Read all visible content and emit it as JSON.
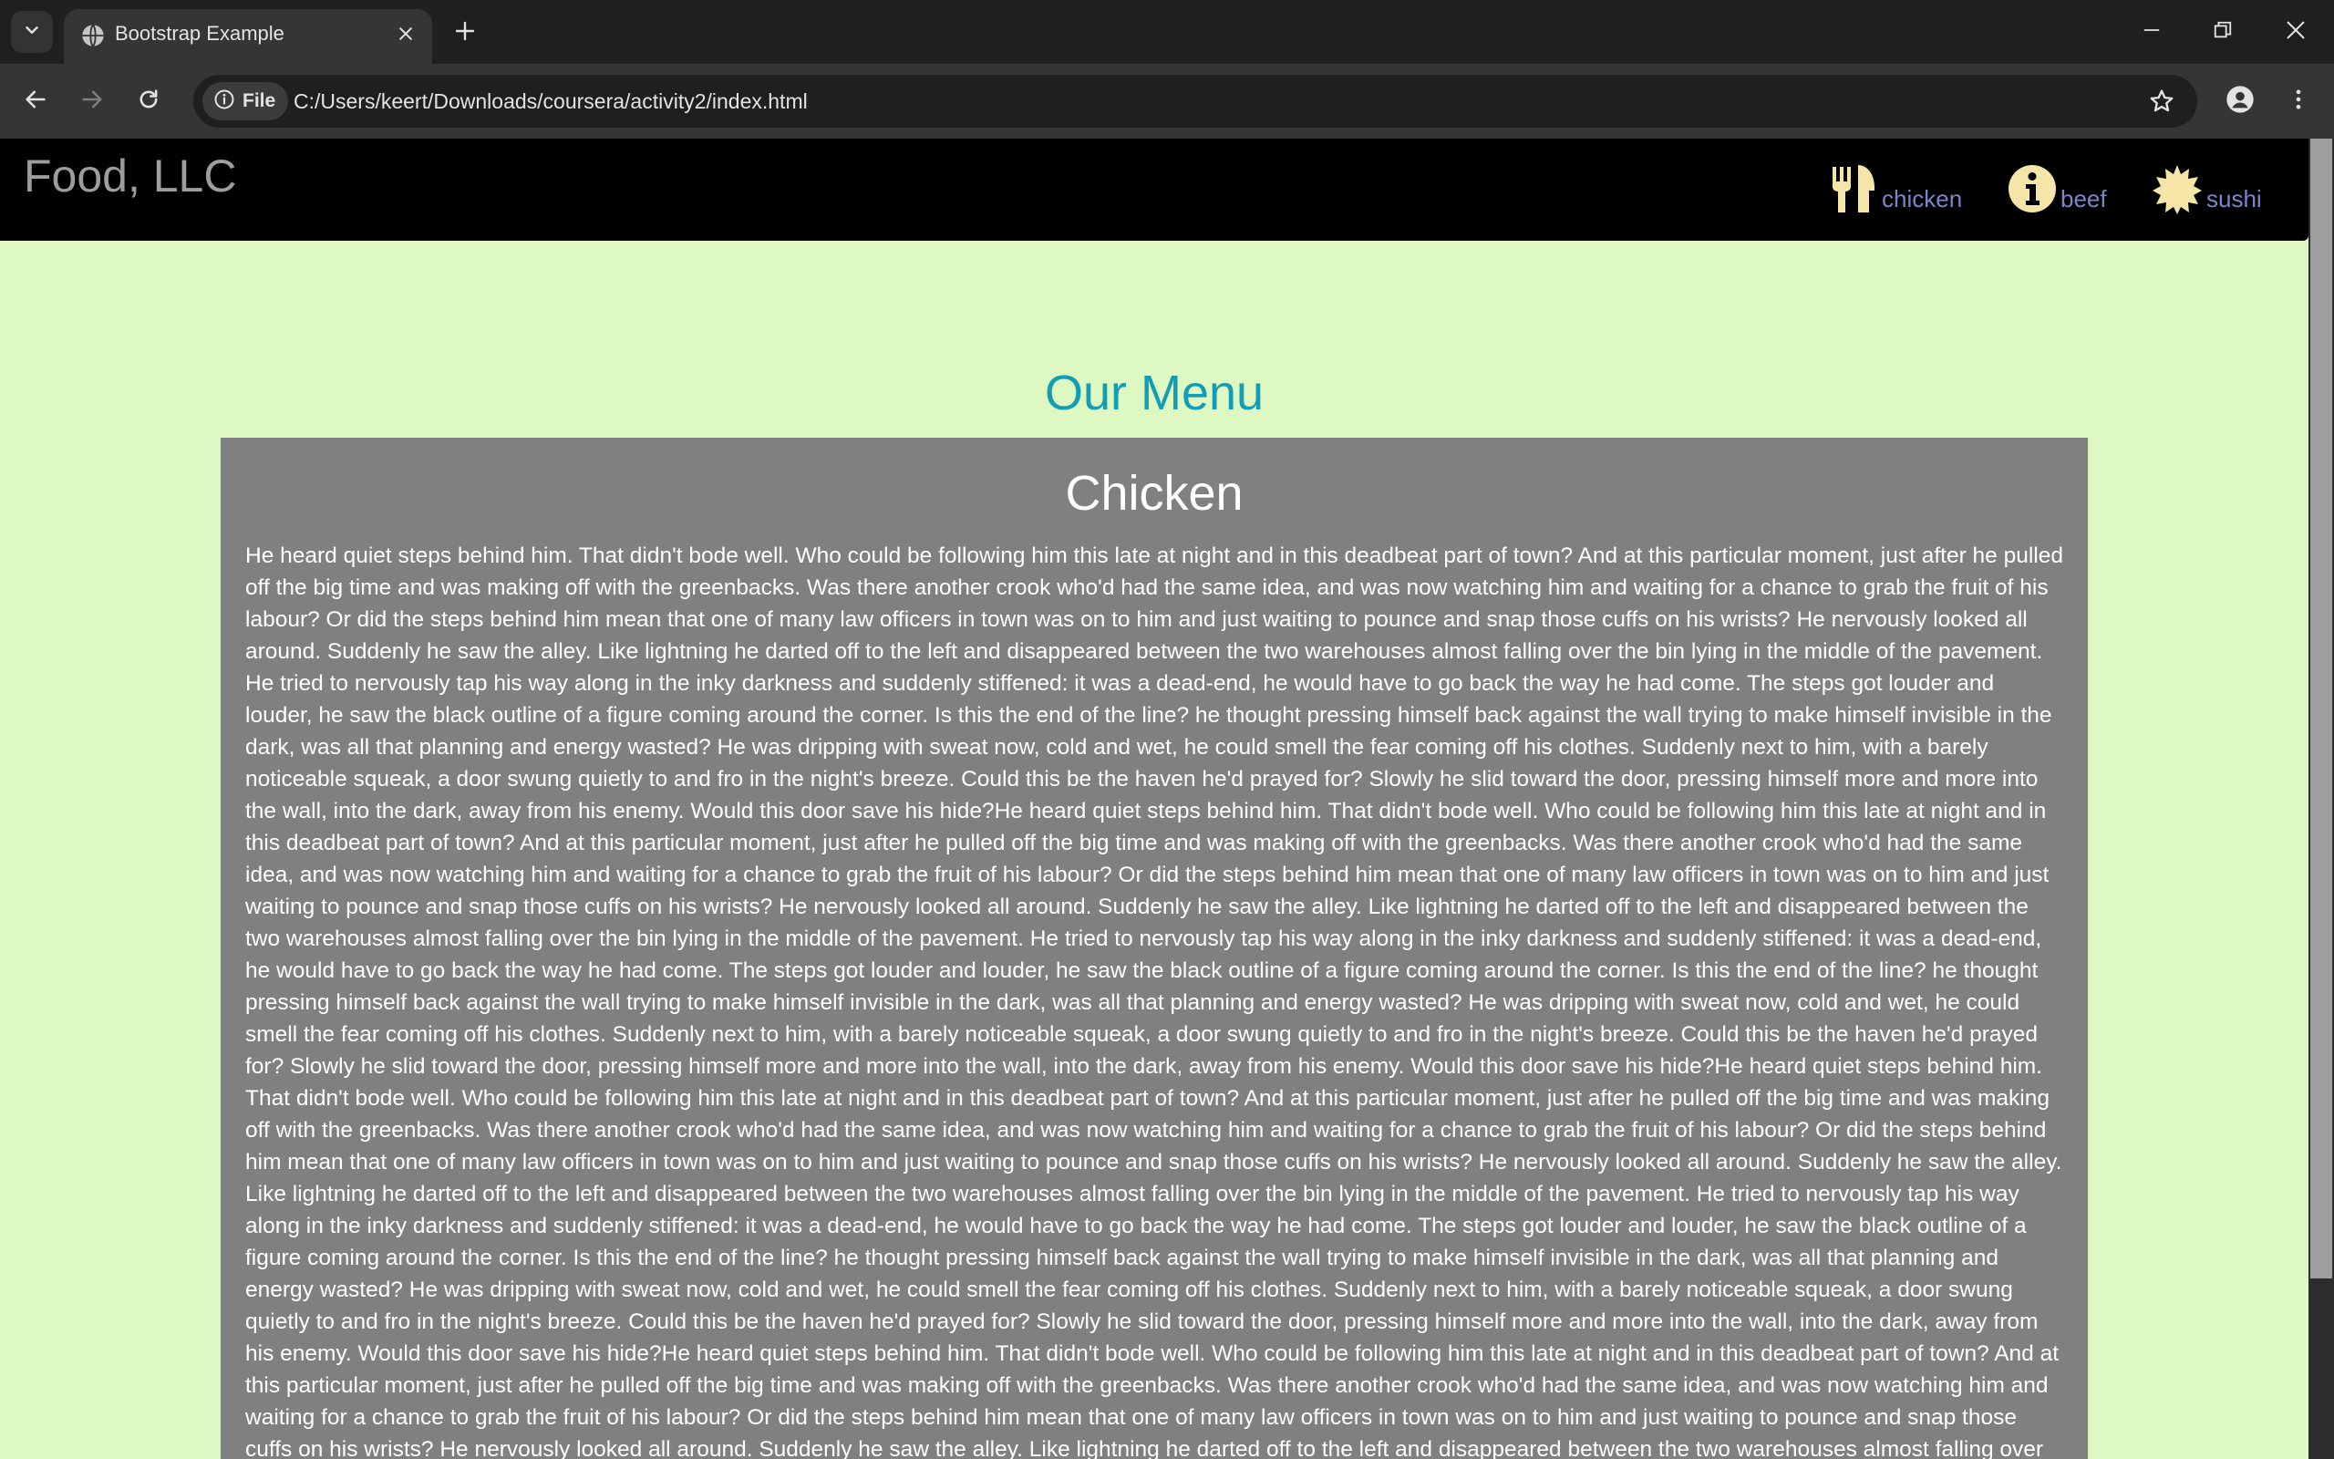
{
  "browser": {
    "tab_title": "Bootstrap Example",
    "site_chip_label": "File",
    "url": "C:/Users/keert/Downloads/coursera/activity2/index.html",
    "icons": [
      "tab-list-icon",
      "globe-icon",
      "close-icon",
      "plus-icon",
      "minimize-icon",
      "restore-icon",
      "close-window-icon",
      "back-arrow-icon",
      "forward-arrow-icon",
      "reload-icon",
      "info-icon",
      "star-icon",
      "profile-icon",
      "more-vert-icon"
    ]
  },
  "page": {
    "brand": "Food, LLC",
    "nav": [
      {
        "label": "chicken",
        "icon": "cutlery-icon"
      },
      {
        "label": "beef",
        "icon": "info-sign-icon"
      },
      {
        "label": "sushi",
        "icon": "certificate-icon"
      }
    ],
    "menu_title": "Our Menu",
    "section_title": "Chicken",
    "section_body": "He heard quiet steps behind him. That didn't bode well. Who could be following him this late at night and in this deadbeat part of town? And at this particular moment, just after he pulled off the big time and was making off with the greenbacks. Was there another crook who'd had the same idea, and was now watching him and waiting for a chance to grab the fruit of his labour? Or did the steps behind him mean that one of many law officers in town was on to him and just waiting to pounce and snap those cuffs on his wrists? He nervously looked all around. Suddenly he saw the alley. Like lightning he darted off to the left and disappeared between the two warehouses almost falling over the bin lying in the middle of the pavement. He tried to nervously tap his way along in the inky darkness and suddenly stiffened: it was a dead-end, he would have to go back the way he had come. The steps got louder and louder, he saw the black outline of a figure coming around the corner. Is this the end of the line? he thought pressing himself back against the wall trying to make himself invisible in the dark, was all that planning and energy wasted? He was dripping with sweat now, cold and wet, he could smell the fear coming off his clothes. Suddenly next to him, with a barely noticeable squeak, a door swung quietly to and fro in the night's breeze. Could this be the haven he'd prayed for? Slowly he slid toward the door, pressing himself more and more into the wall, into the dark, away from his enemy. Would this door save his hide?He heard quiet steps behind him. That didn't bode well. Who could be following him this late at night and in this deadbeat part of town? And at this particular moment, just after he pulled off the big time and was making off with the greenbacks. Was there another crook who'd had the same idea, and was now watching him and waiting for a chance to grab the fruit of his labour? Or did the steps behind him mean that one of many law officers in town was on to him and just waiting to pounce and snap those cuffs on his wrists? He nervously looked all around. Suddenly he saw the alley. Like lightning he darted off to the left and disappeared between the two warehouses almost falling over the bin lying in the middle of the pavement. He tried to nervously tap his way along in the inky darkness and suddenly stiffened: it was a dead-end, he would have to go back the way he had come. The steps got louder and louder, he saw the black outline of a figure coming around the corner. Is this the end of the line? he thought pressing himself back against the wall trying to make himself invisible in the dark, was all that planning and energy wasted? He was dripping with sweat now, cold and wet, he could smell the fear coming off his clothes. Suddenly next to him, with a barely noticeable squeak, a door swung quietly to and fro in the night's breeze. Could this be the haven he'd prayed for? Slowly he slid toward the door, pressing himself more and more into the wall, into the dark, away from his enemy. Would this door save his hide?He heard quiet steps behind him. That didn't bode well. Who could be following him this late at night and in this deadbeat part of town? And at this particular moment, just after he pulled off the big time and was making off with the greenbacks. Was there another crook who'd had the same idea, and was now watching him and waiting for a chance to grab the fruit of his labour? Or did the steps behind him mean that one of many law officers in town was on to him and just waiting to pounce and snap those cuffs on his wrists? He nervously looked all around. Suddenly he saw the alley. Like lightning he darted off to the left and disappeared between the two warehouses almost falling over the bin lying in the middle of the pavement. He tried to nervously tap his way along in the inky darkness and suddenly stiffened: it was a dead-end, he would have to go back the way he had come. The steps got louder and louder, he saw the black outline of a figure coming around the corner. Is this the end of the line? he thought pressing himself back against the wall trying to make himself invisible in the dark, was all that planning and energy wasted? He was dripping with sweat now, cold and wet, he could smell the fear coming off his clothes. Suddenly next to him, with a barely noticeable squeak, a door swung quietly to and fro in the night's breeze. Could this be the haven he'd prayed for? Slowly he slid toward the door, pressing himself more and more into the wall, into the dark, away from his enemy. Would this door save his hide?He heard quiet steps behind him. That didn't bode well. Who could be following him this late at night and in this deadbeat part of town? And at this particular moment, just after he pulled off the big time and was making off with the greenbacks. Was there another crook who'd had the same idea, and was now watching him and waiting for a chance to grab the fruit of his labour? Or did the steps behind him mean that one of many law officers in town was on to him and just waiting to pounce and snap those cuffs on his wrists? He nervously looked all around. Suddenly he saw the alley. Like lightning he darted off to the left and disappeared between the two warehouses almost falling over",
    "colors": {
      "page_bg": "#ddf9c1",
      "navbar_bg": "#000000",
      "brand": "#9d9d9d",
      "nav_link": "#7b86c8",
      "nav_icon": "#f5e6a8",
      "menu_title": "#139db5",
      "panel_bg": "#808080",
      "panel_text": "#ffffff"
    }
  }
}
